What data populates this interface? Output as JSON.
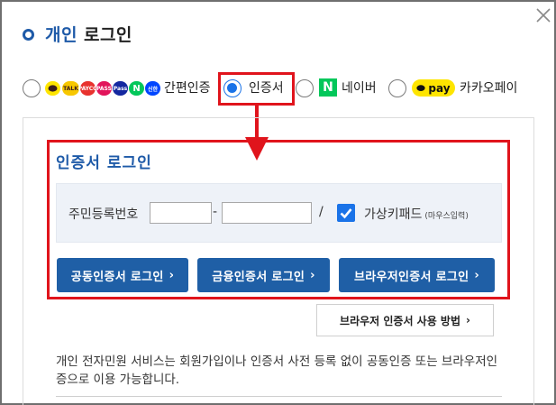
{
  "header": {
    "title_accent": "개인",
    "title_rest": "로그인"
  },
  "login_options": [
    {
      "label": "간편인증",
      "selected": false,
      "logos": [
        "kakao-icon",
        "talk-icon",
        "payco-icon",
        "pass-icon",
        "samsung-pass-icon",
        "naver-icon",
        "shinhan-icon"
      ]
    },
    {
      "label": "인증서",
      "selected": true
    },
    {
      "label": "네이버",
      "selected": false,
      "logo_text": "N"
    },
    {
      "label": "카카오페이",
      "selected": false,
      "logo_text": "pay"
    }
  ],
  "logos": {
    "talk": "TALK",
    "payco": "PAYCO",
    "pass": "PASS",
    "samsung": "Pass",
    "naver": "N",
    "shinhan": "신한"
  },
  "cert_panel": {
    "title": "인증서 로그인",
    "id_label": "주민등록번호",
    "id_part1": "",
    "id_part2": "",
    "dash": "-",
    "slash": "/",
    "virtual_keypad_label": "가상키패드",
    "virtual_keypad_sub": "(마우스입력)",
    "virtual_keypad_checked": true,
    "buttons": {
      "joint_cert": "공동인증서 로그인",
      "financial_cert": "금융인증서 로그인",
      "browser_cert": "브라우저인증서 로그인"
    }
  },
  "method_button": "브라우저 인증서 사용 방법",
  "description": "개인 전자민원 서비스는 회원가입이나 인증서 사전 등록 없이 공동인증 또는 브라우저인증으로 이용 가능합니다.",
  "colors": {
    "accent_blue": "#1e5aa8",
    "button_blue": "#1f5fa6",
    "highlight_red": "#e0141c",
    "naver_green": "#03c75a",
    "kakao_yellow": "#fee500"
  }
}
